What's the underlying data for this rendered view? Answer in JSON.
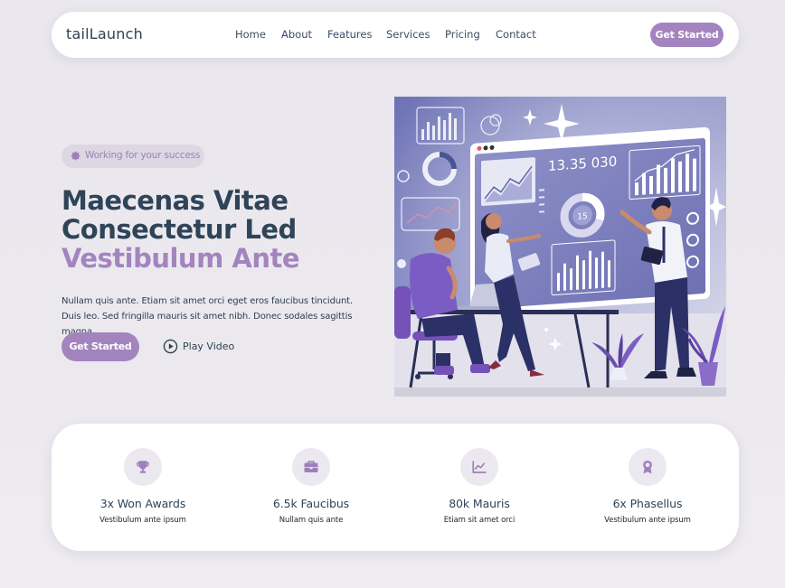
{
  "nav": {
    "brand": "tailLaunch",
    "links": [
      "Home",
      "About",
      "Features",
      "Services",
      "Pricing",
      "Contact"
    ],
    "cta": "Get Started"
  },
  "hero": {
    "badge": "Working for your success",
    "badge_icon": "gear-icon",
    "title_line1": "Maecenas Vitae",
    "title_line2": "Consectetur Led",
    "title_line3": "Vestibulum Ante",
    "description": "Nullam quis ante. Etiam sit amet orci eget eros faucibus tincidunt. Duis leo. Sed fringilla mauris sit amet nibh. Donec sodales sagittis magna.",
    "cta": "Get Started",
    "play_label": "Play Video",
    "play_icon": "play-circle-icon",
    "image_labels": {
      "screen_number": "13.35 030",
      "donut_label": "15"
    }
  },
  "stats": [
    {
      "icon": "trophy-icon",
      "title": "3x Won Awards",
      "subtitle": "Vestibulum ante ipsum"
    },
    {
      "icon": "briefcase-icon",
      "title": "6.5k Faucibus",
      "subtitle": "Nullam quis ante"
    },
    {
      "icon": "chart-line-icon",
      "title": "80k Mauris",
      "subtitle": "Etiam sit amet orci"
    },
    {
      "icon": "award-icon",
      "title": "6x Phasellus",
      "subtitle": "Vestibulum ante ipsum"
    }
  ],
  "colors": {
    "accent": "#a384bf",
    "heading": "#2f4458",
    "background": "#eae8ee",
    "badge_bg": "#dcd7e3"
  }
}
